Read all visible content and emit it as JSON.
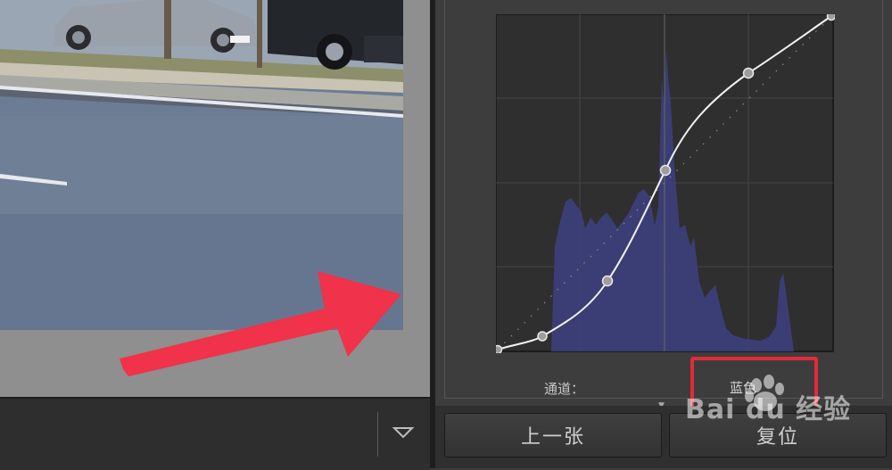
{
  "curves": {
    "channel_label": "通道：",
    "channel_value": "蓝色",
    "accent_color": "#e22b3a",
    "histogram_color": "#3c3f78",
    "curve_color": "#f2f2f2"
  },
  "buttons": {
    "previous_label": "上一张",
    "reset_label": "复位"
  },
  "dropdown": {
    "icon": "chevron-down-icon"
  },
  "watermark": {
    "text": "Bai du 经验",
    "icon": "paw-icon"
  },
  "annotation": {
    "arrow_color": "#f0324a"
  }
}
